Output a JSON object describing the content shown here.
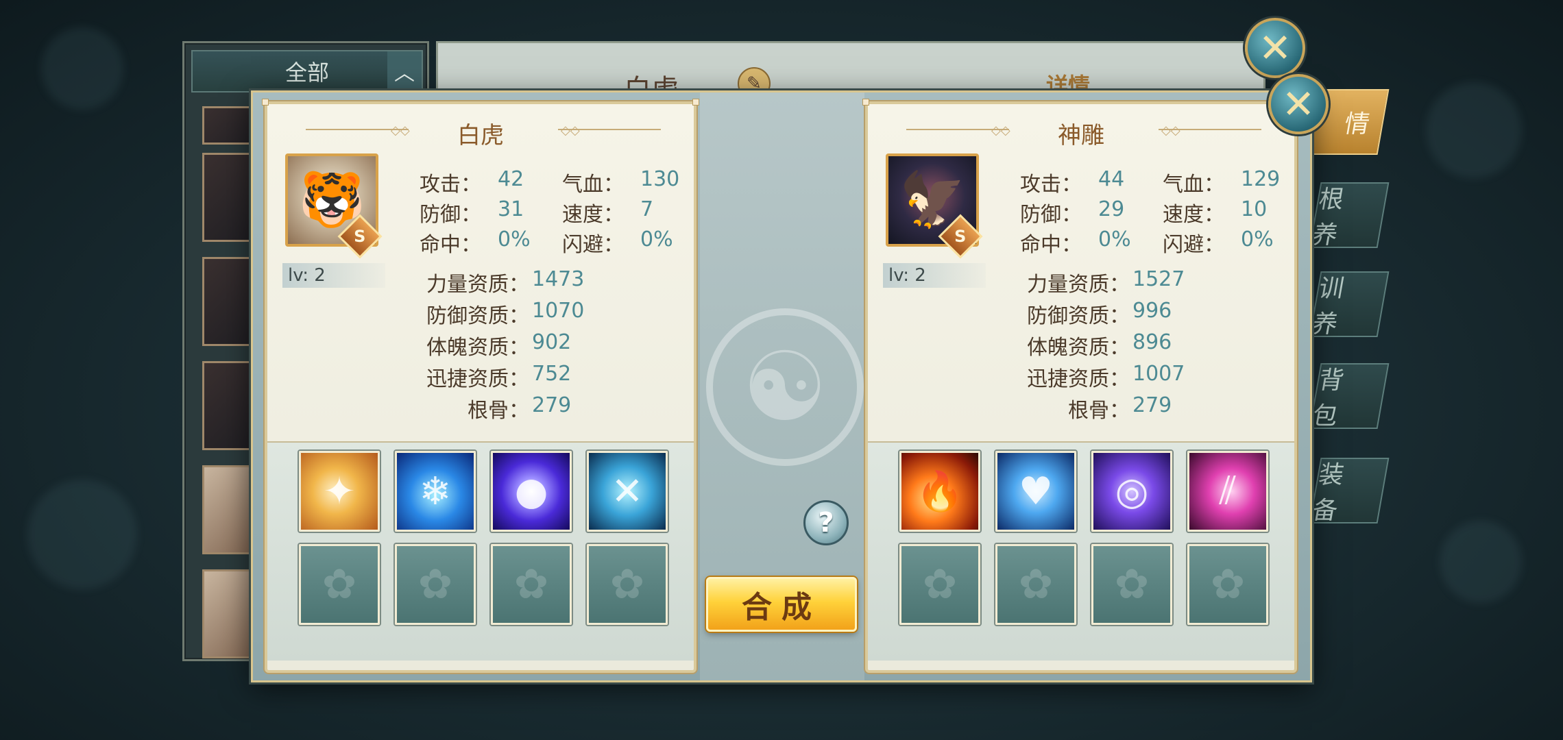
{
  "background": {
    "filter_label": "全部",
    "filter_arrow": "︿",
    "main_title": "白虎",
    "detail_title": "详情",
    "side_tabs": [
      "情",
      "根 养",
      "训 养",
      "背 包",
      "装 备"
    ]
  },
  "overlay": {
    "compose_label": "合成",
    "help_label": "?",
    "left": {
      "name": "白虎",
      "grade": "S",
      "level": "lv: 2",
      "stats": [
        {
          "label": "攻击：",
          "value": "42"
        },
        {
          "label": "气血：",
          "value": "130"
        },
        {
          "label": "防御：",
          "value": "31"
        },
        {
          "label": "速度：",
          "value": "7"
        },
        {
          "label": "命中：",
          "value": "0%"
        },
        {
          "label": "闪避：",
          "value": "0%"
        }
      ],
      "aptitudes": [
        {
          "label": "力量资质：",
          "value": "1473"
        },
        {
          "label": "防御资质：",
          "value": "1070"
        },
        {
          "label": "体魄资质：",
          "value": "902"
        },
        {
          "label": "迅捷资质：",
          "value": "752"
        },
        {
          "label": "根骨：",
          "value": "279"
        }
      ],
      "skills": [
        "tiger-skill-icon",
        "ice-beast-skill-icon",
        "energy-orb-skill-icon",
        "chain-skill-icon"
      ]
    },
    "right": {
      "name": "神雕",
      "grade": "S",
      "level": "lv: 2",
      "stats": [
        {
          "label": "攻击：",
          "value": "44"
        },
        {
          "label": "气血：",
          "value": "129"
        },
        {
          "label": "防御：",
          "value": "29"
        },
        {
          "label": "速度：",
          "value": "10"
        },
        {
          "label": "命中：",
          "value": "0%"
        },
        {
          "label": "闪避：",
          "value": "0%"
        }
      ],
      "aptitudes": [
        {
          "label": "力量资质：",
          "value": "1527"
        },
        {
          "label": "防御资质：",
          "value": "996"
        },
        {
          "label": "体魄资质：",
          "value": "896"
        },
        {
          "label": "迅捷资质：",
          "value": "1007"
        },
        {
          "label": "根骨：",
          "value": "279"
        }
      ],
      "skills": [
        "phoenix-fire-skill-icon",
        "heart-shield-skill-icon",
        "vortex-skill-icon",
        "claw-slash-skill-icon"
      ]
    }
  }
}
